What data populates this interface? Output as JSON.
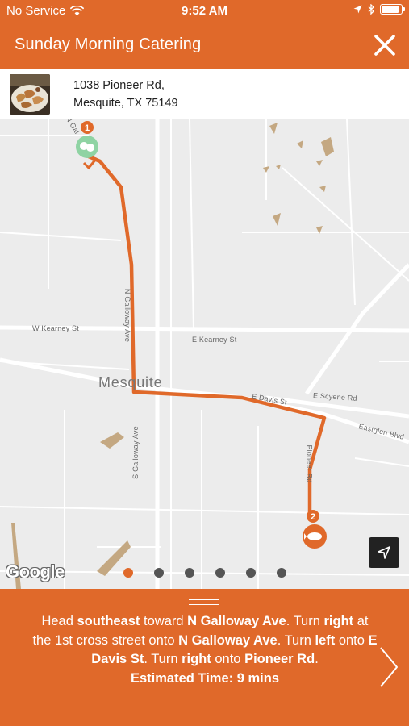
{
  "status_bar": {
    "carrier": "No Service",
    "time": "9:52 AM",
    "battery_level": 0.9
  },
  "header": {
    "title": "Sunday Morning Catering",
    "close_icon": "close-icon"
  },
  "address": {
    "line1": "1038 Pioneer Rd,",
    "line2": "Mesquite, TX 75149"
  },
  "map": {
    "city": "Mesquite",
    "streets": {
      "w_kearney": "W Kearney St",
      "e_kearney": "E Kearney St",
      "e_scyene": "E Scyene Rd",
      "eastglen": "Eastglen Blvd",
      "s_galloway": "S Galloway Ave",
      "n_galloway": "N Galloway Ave",
      "n_gal_short": "N Gal",
      "e_davis": "E Davis St",
      "pioneer": "Pioneer Rd"
    },
    "markers": [
      {
        "number": "1",
        "icon": "theater-masks-icon"
      },
      {
        "number": "2",
        "icon": "food-plate-icon"
      }
    ],
    "attribution": "Google",
    "route_color": "#e0692a"
  },
  "pagination": {
    "count": 6,
    "active_index": 0
  },
  "directions": {
    "seg1": "Head ",
    "b1": "southeast",
    "seg2": " toward ",
    "b2": "N Galloway Ave",
    "seg3": ". Turn ",
    "b3": "right",
    "seg4": " at the 1st cross street onto ",
    "b4": "N Galloway Ave",
    "seg5": ". Turn ",
    "b5": "left",
    "seg6": " onto ",
    "b6": "E Davis St",
    "seg7": ". Turn ",
    "b7": "right",
    "seg8": " onto ",
    "b8": "Pioneer Rd",
    "seg9": ".",
    "eta": "Estimated Time: 9 mins"
  },
  "colors": {
    "accent": "#e0692a",
    "map_bg": "#ececec"
  }
}
